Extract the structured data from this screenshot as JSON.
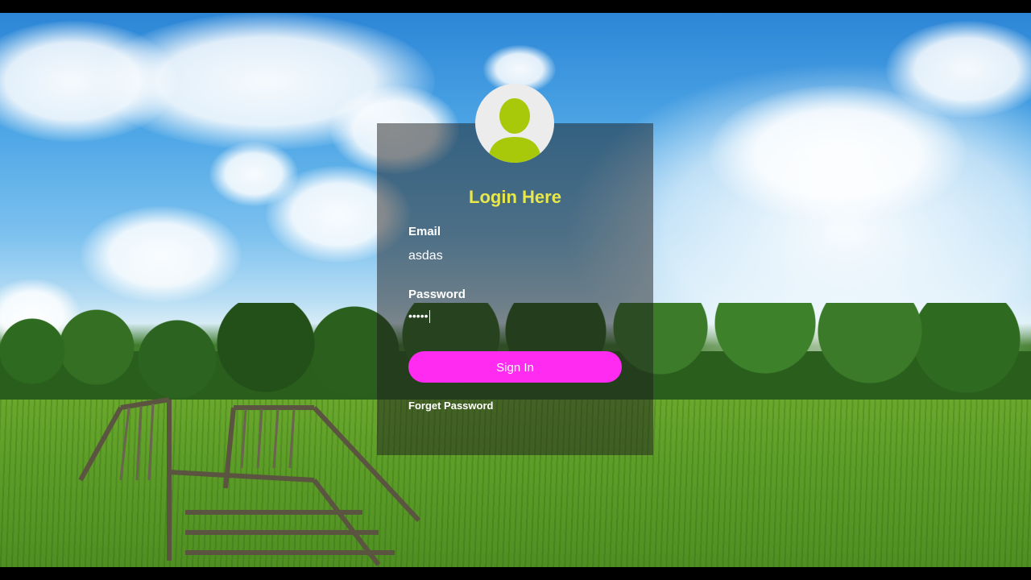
{
  "login": {
    "title": "Login Here",
    "email_label": "Email",
    "email_value": "asdas",
    "password_label": "Password",
    "password_masked": "•••••",
    "signin_label": "Sign In",
    "forgot_label": "Forget Password"
  },
  "colors": {
    "title": "#e8e84a",
    "button": "#ff2bf0",
    "avatar": "#a8c90a"
  },
  "icons": {
    "avatar": "user-avatar-icon"
  }
}
